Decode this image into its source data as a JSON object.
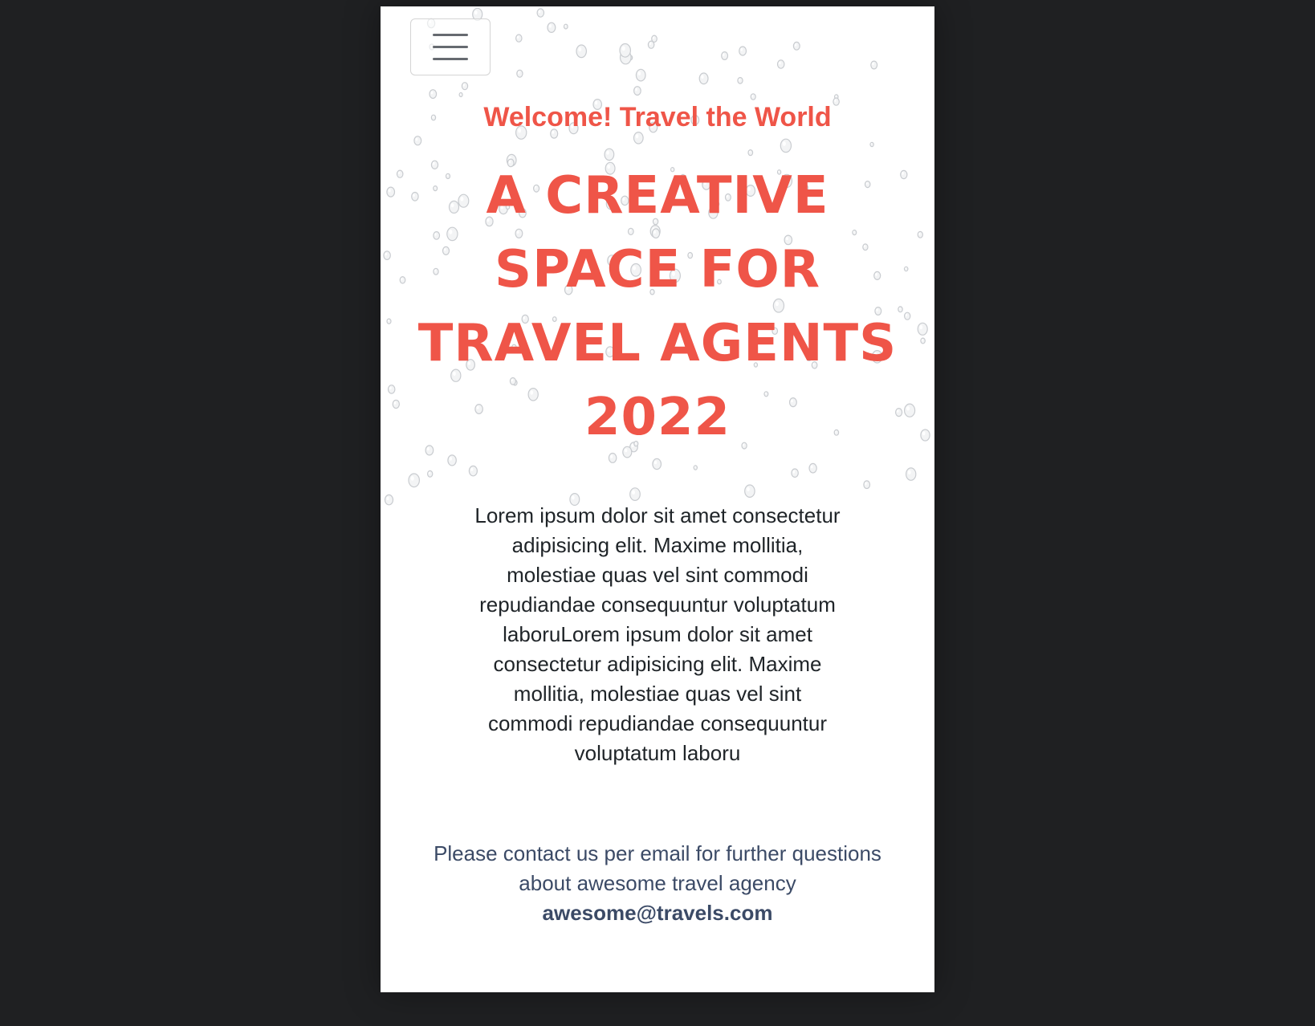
{
  "colors": {
    "page_background": "#1f2022",
    "card_background": "#ffffff",
    "accent": "#ef5548",
    "body_text": "#1f2428",
    "contact_text": "#3b4a66"
  },
  "header": {
    "menu_icon": "hamburger-menu-icon"
  },
  "hero": {
    "welcome": "Welcome! Travel the World",
    "headline_lines": [
      "A CREATIVE",
      "SPACE FOR",
      "TRAVEL AGENTS",
      "2022"
    ]
  },
  "body": {
    "text": "Lorem ipsum dolor sit amet consectetur adipisicing elit. Maxime mollitia, molestiae quas vel sint commodi repudiandae consequuntur voluptatum laboruLorem ipsum dolor sit amet consectetur adipisicing elit. Maxime mollitia, molestiae quas vel sint commodi repudiandae consequuntur voluptatum laboru"
  },
  "contact": {
    "text": "Please contact us per email for further questions about awesome travel agency",
    "email": "awesome@travels.com"
  }
}
